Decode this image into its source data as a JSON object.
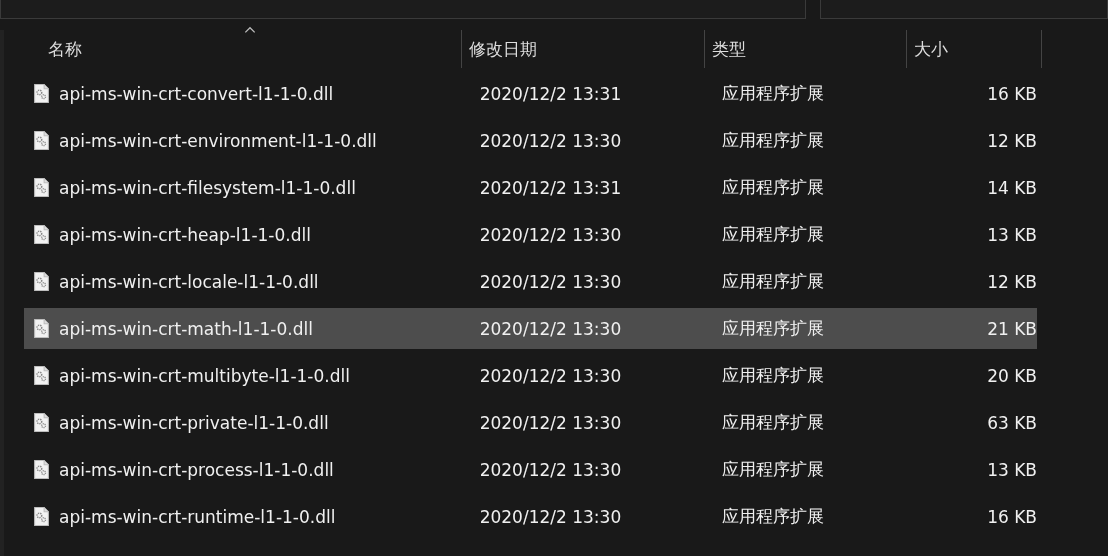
{
  "columns": [
    {
      "label": "名称",
      "sorted": true
    },
    {
      "label": "修改日期",
      "sorted": false
    },
    {
      "label": "类型",
      "sorted": false
    },
    {
      "label": "大小",
      "sorted": false
    }
  ],
  "files": [
    {
      "name": "api-ms-win-crt-convert-l1-1-0.dll",
      "date": "2020/12/2 13:31",
      "type": "应用程序扩展",
      "size": "16 KB",
      "selected": false
    },
    {
      "name": "api-ms-win-crt-environment-l1-1-0.dll",
      "date": "2020/12/2 13:30",
      "type": "应用程序扩展",
      "size": "12 KB",
      "selected": false
    },
    {
      "name": "api-ms-win-crt-filesystem-l1-1-0.dll",
      "date": "2020/12/2 13:31",
      "type": "应用程序扩展",
      "size": "14 KB",
      "selected": false
    },
    {
      "name": "api-ms-win-crt-heap-l1-1-0.dll",
      "date": "2020/12/2 13:30",
      "type": "应用程序扩展",
      "size": "13 KB",
      "selected": false
    },
    {
      "name": "api-ms-win-crt-locale-l1-1-0.dll",
      "date": "2020/12/2 13:30",
      "type": "应用程序扩展",
      "size": "12 KB",
      "selected": false
    },
    {
      "name": "api-ms-win-crt-math-l1-1-0.dll",
      "date": "2020/12/2 13:30",
      "type": "应用程序扩展",
      "size": "21 KB",
      "selected": true
    },
    {
      "name": "api-ms-win-crt-multibyte-l1-1-0.dll",
      "date": "2020/12/2 13:30",
      "type": "应用程序扩展",
      "size": "20 KB",
      "selected": false
    },
    {
      "name": "api-ms-win-crt-private-l1-1-0.dll",
      "date": "2020/12/2 13:30",
      "type": "应用程序扩展",
      "size": "63 KB",
      "selected": false
    },
    {
      "name": "api-ms-win-crt-process-l1-1-0.dll",
      "date": "2020/12/2 13:30",
      "type": "应用程序扩展",
      "size": "13 KB",
      "selected": false
    },
    {
      "name": "api-ms-win-crt-runtime-l1-1-0.dll",
      "date": "2020/12/2 13:30",
      "type": "应用程序扩展",
      "size": "16 KB",
      "selected": false
    }
  ]
}
